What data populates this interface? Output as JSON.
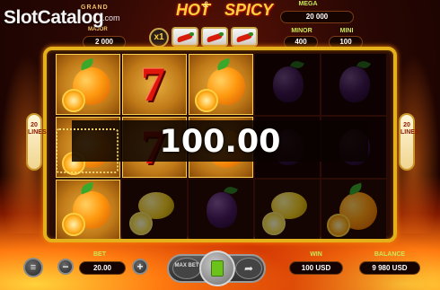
{
  "watermark": {
    "brand": "SlotCatalog",
    "sub": ".com"
  },
  "title": {
    "word1": "HOT",
    "amp": "&",
    "word2": "SPICY"
  },
  "jackpots": {
    "grand_label": "GRAND",
    "major_label": "MAJOR",
    "major_value": "2 000",
    "mega_label": "MEGA",
    "mega_value": "20 000",
    "minor_label": "MINOR",
    "minor_value": "400",
    "mini_label": "MINI",
    "mini_value": "100"
  },
  "multiplier": {
    "label": "x1"
  },
  "lines": {
    "left": "20 LINES",
    "right": "20 LINES"
  },
  "win_banner": {
    "amount": "100.00"
  },
  "reels": [
    [
      "orange",
      "seven",
      "orange-win",
      "plum",
      "plum"
    ],
    [
      "orange",
      "seven",
      "orange",
      "plum",
      "plum"
    ],
    [
      "orange",
      "lemon",
      "plum",
      "lemon",
      "orange"
    ]
  ],
  "bottom_bar": {
    "menu_icon": "menu-icon",
    "bet_label": "BET",
    "bet_value": "20.00",
    "minus": "−",
    "plus": "+",
    "max_bet_label": "MAX BET",
    "win_label": "WIN",
    "win_value": "100 USD",
    "balance_label": "BALANCE",
    "balance_value": "9 980 USD"
  },
  "colors": {
    "frame_gold": "#e4b01c",
    "label_green": "#c9e857",
    "spin_green": "#6cc21a"
  }
}
